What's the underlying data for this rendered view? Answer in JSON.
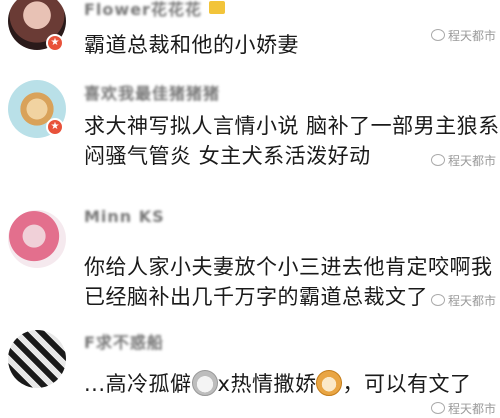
{
  "watermark": "程天都市",
  "comments": [
    {
      "username": "Flower花花花",
      "text_lines": [
        "霸道总裁和他的小娇妻"
      ]
    },
    {
      "username": "喜欢我最佳猪猪猪",
      "text_lines": [
        "求大神写拟人言情小说 脑补了一部男主狼系",
        "闷骚气管炎 女主犬系活泼好动"
      ]
    },
    {
      "username": "Minn KS",
      "text_lines": [
        "你给人家小夫妻放个小三进去他肯定咬啊我",
        "已经脑补出几千万字的霸道总裁文了"
      ]
    },
    {
      "username": "F求不惑船",
      "text_before_cat": "...高冷孤僻",
      "text_mid": "x热情撒娇",
      "text_after_dog": "，可以有文了"
    }
  ]
}
